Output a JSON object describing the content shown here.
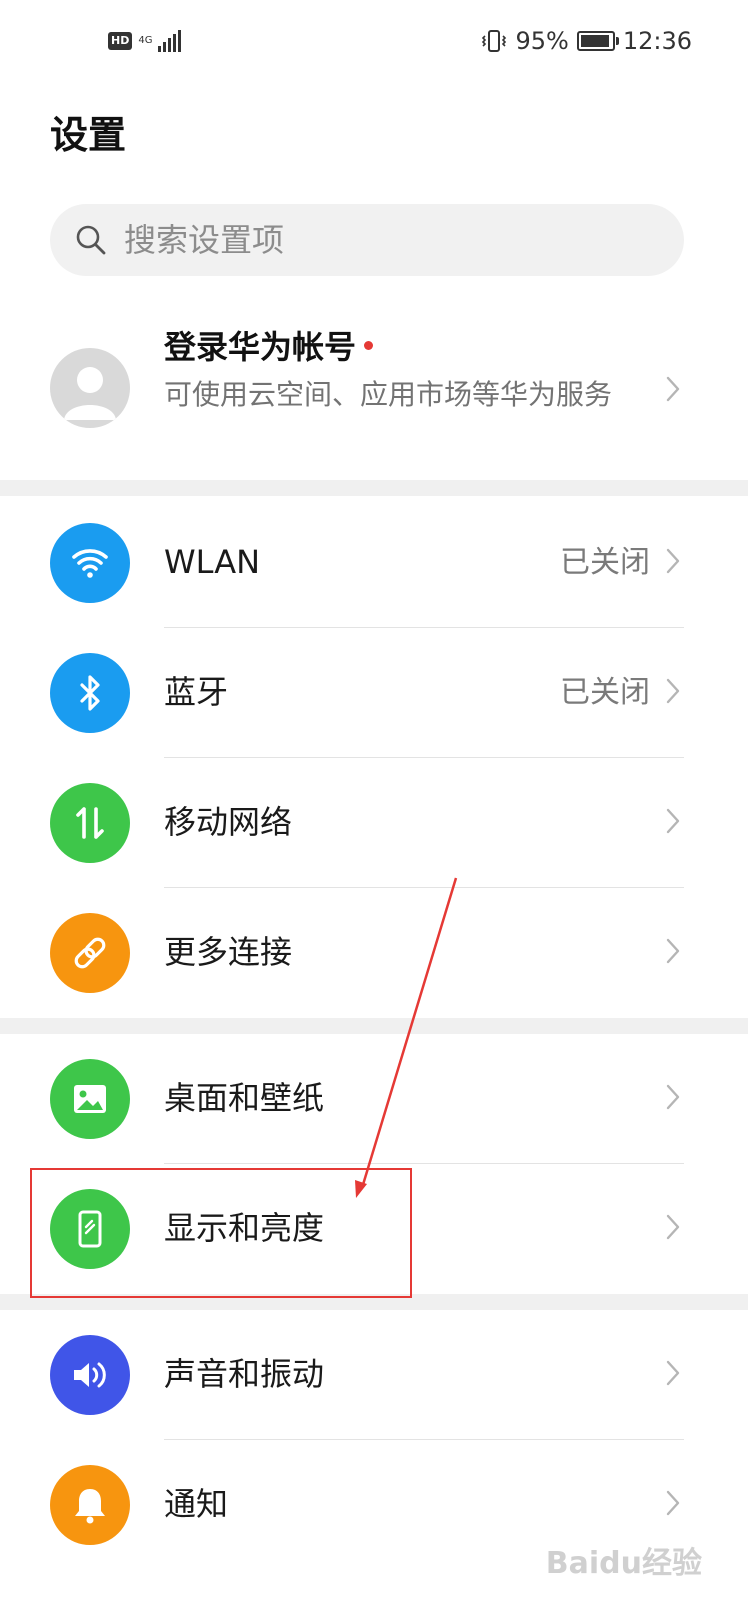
{
  "status_bar": {
    "hd_badge": "HD",
    "network_type": "4G",
    "battery_percent": "95%",
    "battery_level": 0.95,
    "time": "12:36"
  },
  "page_title": "设置",
  "search": {
    "placeholder": "搜索设置项"
  },
  "account": {
    "title": "登录华为帐号",
    "subtitle": "可使用云空间、应用市场等华为服务"
  },
  "settings": {
    "wlan": {
      "label": "WLAN",
      "value": "已关闭",
      "icon": "wifi-icon",
      "color": "#1a9cf0"
    },
    "bluetooth": {
      "label": "蓝牙",
      "value": "已关闭",
      "icon": "bluetooth-icon",
      "color": "#1a9cf0"
    },
    "mobile_network": {
      "label": "移动网络",
      "icon": "mobile-data-icon",
      "color": "#3ec64a"
    },
    "more_connections": {
      "label": "更多连接",
      "icon": "link-icon",
      "color": "#f7950f"
    },
    "home_wallpaper": {
      "label": "桌面和壁纸",
      "icon": "image-icon",
      "color": "#3ec64a"
    },
    "display_brightness": {
      "label": "显示和亮度",
      "icon": "phone-display-icon",
      "color": "#3ec64a"
    },
    "sound_vibration": {
      "label": "声音和振动",
      "icon": "speaker-icon",
      "color": "#4055e8"
    },
    "notifications": {
      "label": "通知",
      "icon": "bell-icon",
      "color": "#f7950f"
    }
  },
  "annotation": {
    "color": "#e53935"
  },
  "watermark": "Baidu经验"
}
